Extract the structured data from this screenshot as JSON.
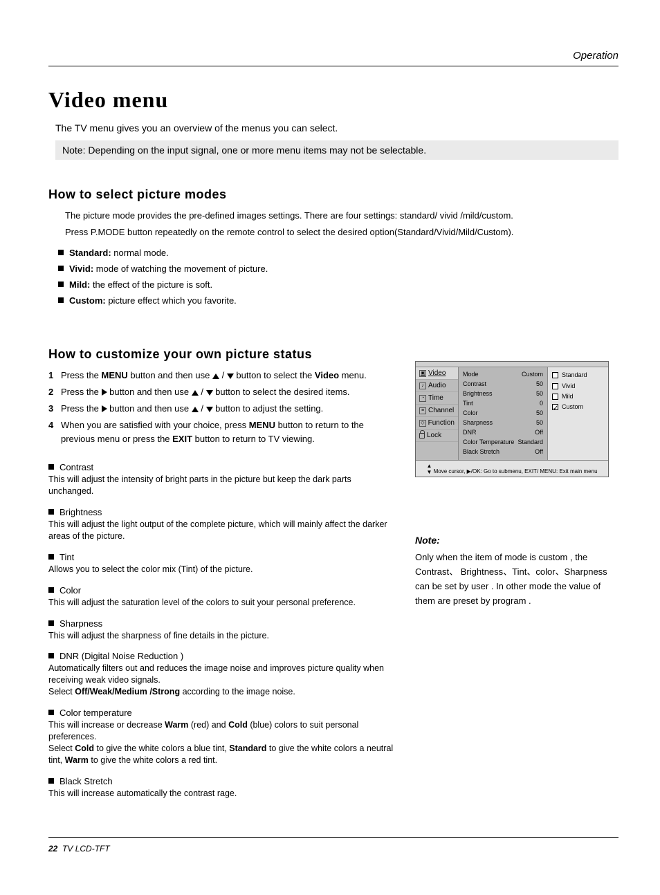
{
  "header": {
    "section": "Operation"
  },
  "title": "Video menu",
  "intro": "The TV menu gives you an overview of the menus you can select.",
  "top_note": "Note: Depending on the input signal, one or more menu items may not be selectable.",
  "sec1": {
    "heading": "How to select picture modes",
    "p1": "The picture mode provides the pre-defined images settings. There are four settings: standard/ vivid /mild/custom.",
    "p2": "Press  P.MODE button repeatedly on the remote control to select the desired option(Standard/Vivid/Mild/Custom).",
    "items": [
      {
        "term": "Standard:",
        "desc": " normal mode."
      },
      {
        "term": "Vivid:",
        "desc": " mode of watching the movement of picture."
      },
      {
        "term": "Mild:",
        "desc": " the effect of the picture is soft."
      },
      {
        "term": "Custom:",
        "desc": " picture effect which you favorite."
      }
    ]
  },
  "sec2": {
    "heading": "How to customize your own picture status",
    "steps": {
      "s1a": "Press the ",
      "s1b": "MENU",
      "s1c": " button and then use ",
      "s1d": " button to select the ",
      "s1e": "Video",
      "s1f": " menu.",
      "s2a": "Press the",
      "s2b": " button and then use ",
      "s2c": " button to select the desired items.",
      "s3a": "Press the",
      "s3b": " button and then use ",
      "s3c": " button to adjust the setting.",
      "s4a": "When you are satisfied with your choice,  press ",
      "s4b": "MENU",
      "s4c": " button to return to the previous menu or press the ",
      "s4d": "EXIT",
      "s4e": " button to return to TV viewing."
    },
    "defs": [
      {
        "head": "Contrast",
        "body": "This will adjust the intensity of bright parts in the picture but keep the dark parts unchanged."
      },
      {
        "head": "Brightness",
        "body": "This will adjust the light output of the complete picture, which will mainly affect the darker areas of the picture."
      },
      {
        "head": "Tint",
        "body": "Allows you to select the color mix (Tint) of the picture."
      },
      {
        "head": "Color",
        "body": "This will adjust the saturation level of the colors to suit your personal preference."
      },
      {
        "head": "Sharpness",
        "body": "This will adjust the sharpness of fine details in the picture."
      }
    ],
    "dnr": {
      "head": "DNR (Digital Noise Reduction )",
      "l1": "Automatically filters out and reduces the image noise and improves picture quality when receiving weak video signals.",
      "l2a": "Select ",
      "l2b": "Off/Weak/Medium /Strong",
      "l2c": " according to the image noise."
    },
    "ct": {
      "head": "Color temperature",
      "l1a": "This will increase or decrease ",
      "l1b": "Warm",
      "l1c": " (red) and ",
      "l1d": "Cold",
      "l1e": " (blue) colors to suit personal preferences.",
      "l2a": "Select ",
      "l2b": "Cold",
      "l2c": " to give the white colors a blue tint, ",
      "l2d": "Standard",
      "l2e": " to give the white colors a neutral tint, ",
      "l2f": "Warm",
      "l2g": " to give the white colors a red tint."
    },
    "bs": {
      "head": "Black Stretch",
      "body": "This will increase automatically the contrast rage."
    }
  },
  "osd": {
    "tabs": [
      "Video",
      "Audio",
      "Time",
      "Channel",
      "Function",
      "Lock"
    ],
    "rows": [
      {
        "k": "Mode",
        "v": "Custom"
      },
      {
        "k": "Contrast",
        "v": "50"
      },
      {
        "k": "Brightness",
        "v": "50"
      },
      {
        "k": "Tint",
        "v": "0"
      },
      {
        "k": "Color",
        "v": "50"
      },
      {
        "k": "Sharpness",
        "v": "50"
      },
      {
        "k": "DNR",
        "v": "Off"
      },
      {
        "k": "Color Temperature",
        "v": "Standard"
      },
      {
        "k": "Black Stretch",
        "v": "Off"
      }
    ],
    "opts": [
      "Standard",
      "Vivid",
      "Mild",
      "Custom"
    ],
    "checked": "Custom",
    "hint": "Move cursor,  ▶/OK: Go to submenu, EXIT/ MENU: Exit main menu"
  },
  "side_note": {
    "head": "Note:",
    "body": "Only when the item of mode is custom , the Contrast、 Brightness、Tint、color、Sharpness can be set by user . In other mode the value of them are preset by program ."
  },
  "footer": {
    "page": "22",
    "model": "TV LCD-TFT"
  }
}
